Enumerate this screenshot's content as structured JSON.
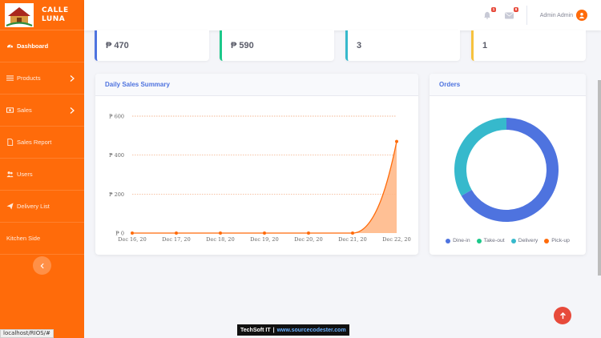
{
  "brand": {
    "line1": "CALLE",
    "line2": "LUNA"
  },
  "sidebar": {
    "items": [
      {
        "label": "Dashboard",
        "icon": "gauge-icon",
        "active": true
      },
      {
        "label": "Products",
        "icon": "list-icon",
        "chevron": true
      },
      {
        "label": "Sales",
        "icon": "money-icon",
        "chevron": true
      },
      {
        "label": "Sales Report",
        "icon": "file-icon"
      },
      {
        "label": "Users",
        "icon": "users-icon"
      },
      {
        "label": "Delivery List",
        "icon": "send-icon"
      },
      {
        "label": "Kitchen Side",
        "icon": ""
      }
    ],
    "toggle_icon": "chevron-left-icon"
  },
  "status_url": "localhost/RIOS/#",
  "topbar": {
    "alerts_count": "1",
    "messages_count": "6",
    "user_name": "Admin Admin"
  },
  "stats": [
    {
      "value": "₱ 470",
      "color": "#4e73df"
    },
    {
      "value": "₱ 590",
      "color": "#1cc88a"
    },
    {
      "value": "3",
      "color": "#36b9cc"
    },
    {
      "value": "1",
      "color": "#f6c23e"
    }
  ],
  "sales_panel": {
    "title": "Daily Sales Summary"
  },
  "orders_panel": {
    "title": "Orders"
  },
  "chart_data": [
    {
      "type": "area",
      "x": [
        "Dec 16, 20",
        "Dec 17, 20",
        "Dec 18, 20",
        "Dec 19, 20",
        "Dec 20, 20",
        "Dec 21, 20",
        "Dec 22, 20"
      ],
      "series": [
        {
          "values": [
            0,
            0,
            0,
            0,
            0,
            0,
            470
          ]
        }
      ],
      "y_ticks": [
        "₱ 0",
        "₱ 200",
        "₱ 400",
        "₱ 600"
      ],
      "ylim": [
        0,
        600
      ],
      "grid": true,
      "colors": {
        "line": "#ff6b0a",
        "fill": "#ffb98a"
      }
    },
    {
      "type": "pie",
      "variant": "doughnut",
      "labels": [
        "Dine-in",
        "Take-out",
        "Delivery",
        "Pick-up"
      ],
      "values": [
        2,
        0,
        1,
        0
      ],
      "colors": [
        "#4e73df",
        "#1cc88a",
        "#36b9cc",
        "#ff6b0a"
      ],
      "legend": "bottom"
    }
  ],
  "watermark": {
    "brand": "TechSoft IT",
    "sep": "|",
    "url": "www.sourcecodester.com"
  }
}
